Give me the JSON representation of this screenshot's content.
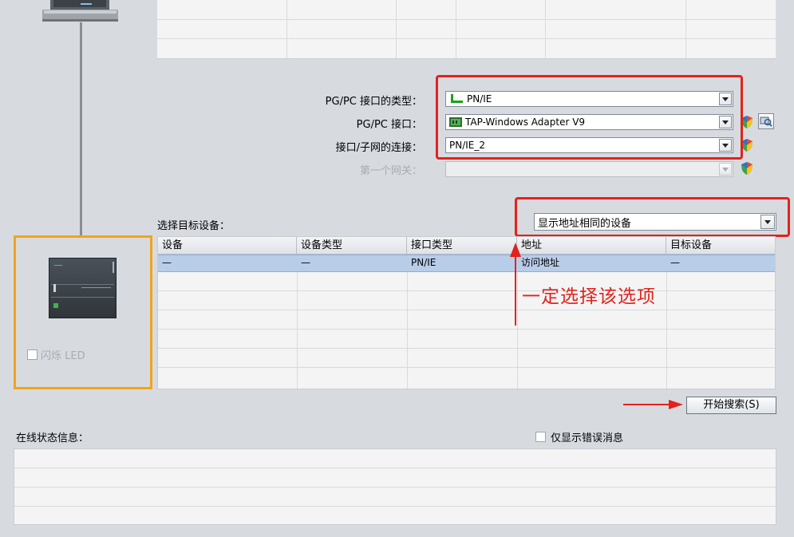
{
  "interface_settings": {
    "pgpc_interface_type_label": "PG/PC 接口的类型：",
    "pgpc_interface_type_value": "PN/IE",
    "pgpc_interface_label": "PG/PC 接口：",
    "pgpc_interface_value": "TAP-Windows Adapter V9",
    "subnet_connection_label": "接口/子网的连接：",
    "subnet_connection_value": "PN/IE_2",
    "first_gateway_label": "第一个网关：",
    "first_gateway_value": ""
  },
  "target_device": {
    "label": "选择目标设备：",
    "filter_value": "显示地址相同的设备",
    "columns": [
      "设备",
      "设备类型",
      "接口类型",
      "地址",
      "目标设备"
    ],
    "rows": [
      [
        "—",
        "—",
        "PN/IE",
        "访问地址",
        "—"
      ]
    ]
  },
  "device_panel": {
    "flash_led_label": "闪烁 LED"
  },
  "search": {
    "start_search_label": "开始搜索(S)"
  },
  "status": {
    "title": "在线状态信息：",
    "only_errors_label": "仅显示错误消息"
  },
  "annotation": {
    "text": "一定选择该选项",
    "color": "#e3221c"
  },
  "colors": {
    "highlight_box": "#e3221c",
    "device_panel_border": "#f3a31b",
    "selected_row": "#b8cde8"
  }
}
